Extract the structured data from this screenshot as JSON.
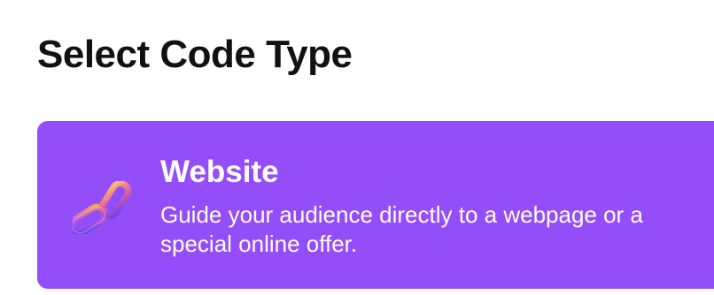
{
  "header": {
    "title": "Select Code Type"
  },
  "code_types": [
    {
      "title": "Website",
      "description": "Guide your audience directly to a webpage or a special online offer.",
      "icon": "link-chain-icon",
      "background": "#944ef9",
      "selected": true
    }
  ],
  "colors": {
    "card_background": "#944ef9",
    "title_text": "#111111",
    "card_text": "#ffffff"
  }
}
